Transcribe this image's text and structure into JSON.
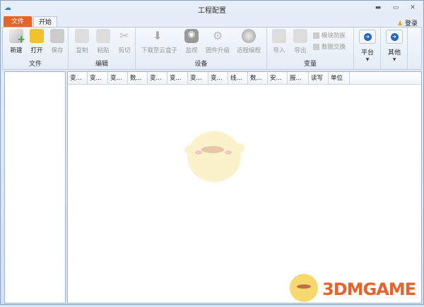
{
  "window": {
    "title": "工程配置"
  },
  "tabs": [
    {
      "label": "文件"
    },
    {
      "label": "开始"
    }
  ],
  "login": "登录",
  "ribbon": {
    "file": {
      "label": "文件",
      "new": "新建",
      "open": "打开",
      "save": "保存"
    },
    "edit": {
      "label": "编辑",
      "copy": "复制",
      "paste": "粘贴",
      "cut": "剪切"
    },
    "device": {
      "label": "设备",
      "download": "下载至云盒子",
      "monitor": "监视",
      "firmware": "固件升级",
      "remote": "远程编程"
    },
    "variable": {
      "label": "变量",
      "import": "导入",
      "export": "导出",
      "module": "模块防拆",
      "exchange": "数据交换"
    },
    "platform": "平台",
    "other": "其他"
  },
  "table": {
    "columns": [
      "变...",
      "变...",
      "变...",
      "数...",
      "变...",
      "变...",
      "变...",
      "变...",
      "线...",
      "数...",
      "安...",
      "报...",
      "读写",
      "单位"
    ]
  },
  "watermark": {
    "logo": "3DMGAME"
  }
}
